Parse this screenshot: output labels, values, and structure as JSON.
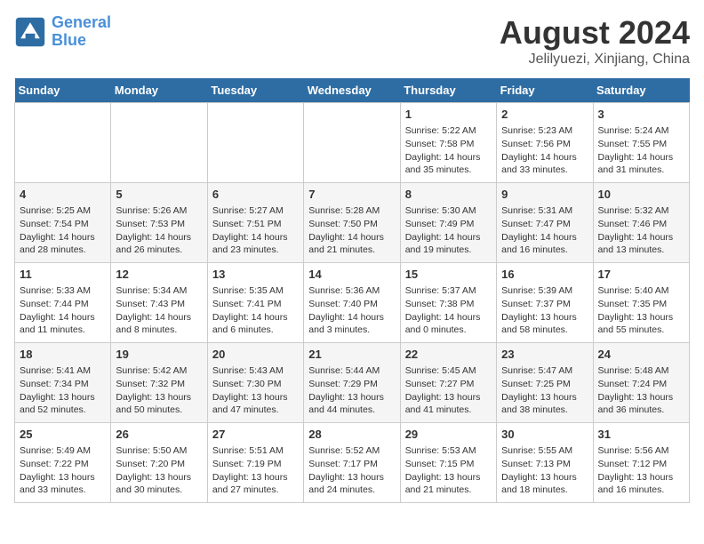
{
  "header": {
    "logo_line1": "General",
    "logo_line2": "Blue",
    "title": "August 2024",
    "subtitle": "Jelilyuezi, Xinjiang, China"
  },
  "weekdays": [
    "Sunday",
    "Monday",
    "Tuesday",
    "Wednesday",
    "Thursday",
    "Friday",
    "Saturday"
  ],
  "weeks": [
    [
      {
        "day": "",
        "info": ""
      },
      {
        "day": "",
        "info": ""
      },
      {
        "day": "",
        "info": ""
      },
      {
        "day": "",
        "info": ""
      },
      {
        "day": "1",
        "info": "Sunrise: 5:22 AM\nSunset: 7:58 PM\nDaylight: 14 hours\nand 35 minutes."
      },
      {
        "day": "2",
        "info": "Sunrise: 5:23 AM\nSunset: 7:56 PM\nDaylight: 14 hours\nand 33 minutes."
      },
      {
        "day": "3",
        "info": "Sunrise: 5:24 AM\nSunset: 7:55 PM\nDaylight: 14 hours\nand 31 minutes."
      }
    ],
    [
      {
        "day": "4",
        "info": "Sunrise: 5:25 AM\nSunset: 7:54 PM\nDaylight: 14 hours\nand 28 minutes."
      },
      {
        "day": "5",
        "info": "Sunrise: 5:26 AM\nSunset: 7:53 PM\nDaylight: 14 hours\nand 26 minutes."
      },
      {
        "day": "6",
        "info": "Sunrise: 5:27 AM\nSunset: 7:51 PM\nDaylight: 14 hours\nand 23 minutes."
      },
      {
        "day": "7",
        "info": "Sunrise: 5:28 AM\nSunset: 7:50 PM\nDaylight: 14 hours\nand 21 minutes."
      },
      {
        "day": "8",
        "info": "Sunrise: 5:30 AM\nSunset: 7:49 PM\nDaylight: 14 hours\nand 19 minutes."
      },
      {
        "day": "9",
        "info": "Sunrise: 5:31 AM\nSunset: 7:47 PM\nDaylight: 14 hours\nand 16 minutes."
      },
      {
        "day": "10",
        "info": "Sunrise: 5:32 AM\nSunset: 7:46 PM\nDaylight: 14 hours\nand 13 minutes."
      }
    ],
    [
      {
        "day": "11",
        "info": "Sunrise: 5:33 AM\nSunset: 7:44 PM\nDaylight: 14 hours\nand 11 minutes."
      },
      {
        "day": "12",
        "info": "Sunrise: 5:34 AM\nSunset: 7:43 PM\nDaylight: 14 hours\nand 8 minutes."
      },
      {
        "day": "13",
        "info": "Sunrise: 5:35 AM\nSunset: 7:41 PM\nDaylight: 14 hours\nand 6 minutes."
      },
      {
        "day": "14",
        "info": "Sunrise: 5:36 AM\nSunset: 7:40 PM\nDaylight: 14 hours\nand 3 minutes."
      },
      {
        "day": "15",
        "info": "Sunrise: 5:37 AM\nSunset: 7:38 PM\nDaylight: 14 hours\nand 0 minutes."
      },
      {
        "day": "16",
        "info": "Sunrise: 5:39 AM\nSunset: 7:37 PM\nDaylight: 13 hours\nand 58 minutes."
      },
      {
        "day": "17",
        "info": "Sunrise: 5:40 AM\nSunset: 7:35 PM\nDaylight: 13 hours\nand 55 minutes."
      }
    ],
    [
      {
        "day": "18",
        "info": "Sunrise: 5:41 AM\nSunset: 7:34 PM\nDaylight: 13 hours\nand 52 minutes."
      },
      {
        "day": "19",
        "info": "Sunrise: 5:42 AM\nSunset: 7:32 PM\nDaylight: 13 hours\nand 50 minutes."
      },
      {
        "day": "20",
        "info": "Sunrise: 5:43 AM\nSunset: 7:30 PM\nDaylight: 13 hours\nand 47 minutes."
      },
      {
        "day": "21",
        "info": "Sunrise: 5:44 AM\nSunset: 7:29 PM\nDaylight: 13 hours\nand 44 minutes."
      },
      {
        "day": "22",
        "info": "Sunrise: 5:45 AM\nSunset: 7:27 PM\nDaylight: 13 hours\nand 41 minutes."
      },
      {
        "day": "23",
        "info": "Sunrise: 5:47 AM\nSunset: 7:25 PM\nDaylight: 13 hours\nand 38 minutes."
      },
      {
        "day": "24",
        "info": "Sunrise: 5:48 AM\nSunset: 7:24 PM\nDaylight: 13 hours\nand 36 minutes."
      }
    ],
    [
      {
        "day": "25",
        "info": "Sunrise: 5:49 AM\nSunset: 7:22 PM\nDaylight: 13 hours\nand 33 minutes."
      },
      {
        "day": "26",
        "info": "Sunrise: 5:50 AM\nSunset: 7:20 PM\nDaylight: 13 hours\nand 30 minutes."
      },
      {
        "day": "27",
        "info": "Sunrise: 5:51 AM\nSunset: 7:19 PM\nDaylight: 13 hours\nand 27 minutes."
      },
      {
        "day": "28",
        "info": "Sunrise: 5:52 AM\nSunset: 7:17 PM\nDaylight: 13 hours\nand 24 minutes."
      },
      {
        "day": "29",
        "info": "Sunrise: 5:53 AM\nSunset: 7:15 PM\nDaylight: 13 hours\nand 21 minutes."
      },
      {
        "day": "30",
        "info": "Sunrise: 5:55 AM\nSunset: 7:13 PM\nDaylight: 13 hours\nand 18 minutes."
      },
      {
        "day": "31",
        "info": "Sunrise: 5:56 AM\nSunset: 7:12 PM\nDaylight: 13 hours\nand 16 minutes."
      }
    ]
  ]
}
